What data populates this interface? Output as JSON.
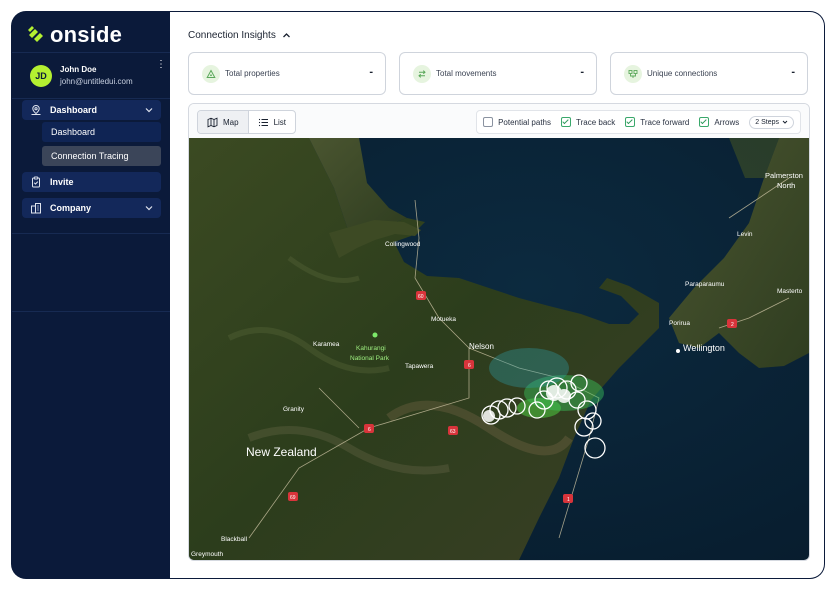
{
  "brand": {
    "name": "onside",
    "accent": "#b4f031"
  },
  "user": {
    "initials": "JD",
    "name": "John Doe",
    "email": "john@untitledui.com"
  },
  "nav": {
    "dashboard": {
      "label": "Dashboard",
      "icon": "map-pin-icon"
    },
    "dashboard_sub": [
      {
        "label": "Dashboard"
      },
      {
        "label": "Connection Tracing",
        "active": true
      }
    ],
    "invite": {
      "label": "Invite",
      "icon": "clipboard-check-icon"
    },
    "company": {
      "label": "Company",
      "icon": "building-icon"
    }
  },
  "insights": {
    "title": "Connection Insights",
    "cards": [
      {
        "label": "Total properties",
        "value": "-",
        "icon": "triangle-icon"
      },
      {
        "label": "Total movements",
        "value": "-",
        "icon": "switch-arrows-icon"
      },
      {
        "label": "Unique connections",
        "value": "-",
        "icon": "connections-icon"
      }
    ]
  },
  "view_toggle": {
    "map": "Map",
    "list": "List",
    "selected": "Map"
  },
  "options": {
    "potential_paths": {
      "label": "Potential paths",
      "checked": false
    },
    "trace_back": {
      "label": "Trace back",
      "checked": true
    },
    "trace_forward": {
      "label": "Trace forward",
      "checked": true
    },
    "arrows": {
      "label": "Arrows",
      "checked": true
    },
    "steps": "2 Steps"
  },
  "map": {
    "labels": {
      "collingwood": "Collingwood",
      "karamea": "Karamea",
      "kahurangi1": "Kahurangi",
      "kahurangi2": "National Park",
      "motueka": "Motueka",
      "nelson": "Nelson",
      "tapawera": "Tapawera",
      "granity": "Granity",
      "new_zealand": "New Zealand",
      "blackball": "Blackball",
      "greymouth": "Greymouth",
      "palmerston1": "Palmerston",
      "palmerston2": "North",
      "levin": "Levin",
      "paraparaumu": "Paraparaumu",
      "masterton": "Masterto",
      "porirua": "Porirua",
      "wellington": "Wellington"
    },
    "shields": [
      "60",
      "6",
      "6",
      "63",
      "69",
      "1",
      "2"
    ]
  }
}
